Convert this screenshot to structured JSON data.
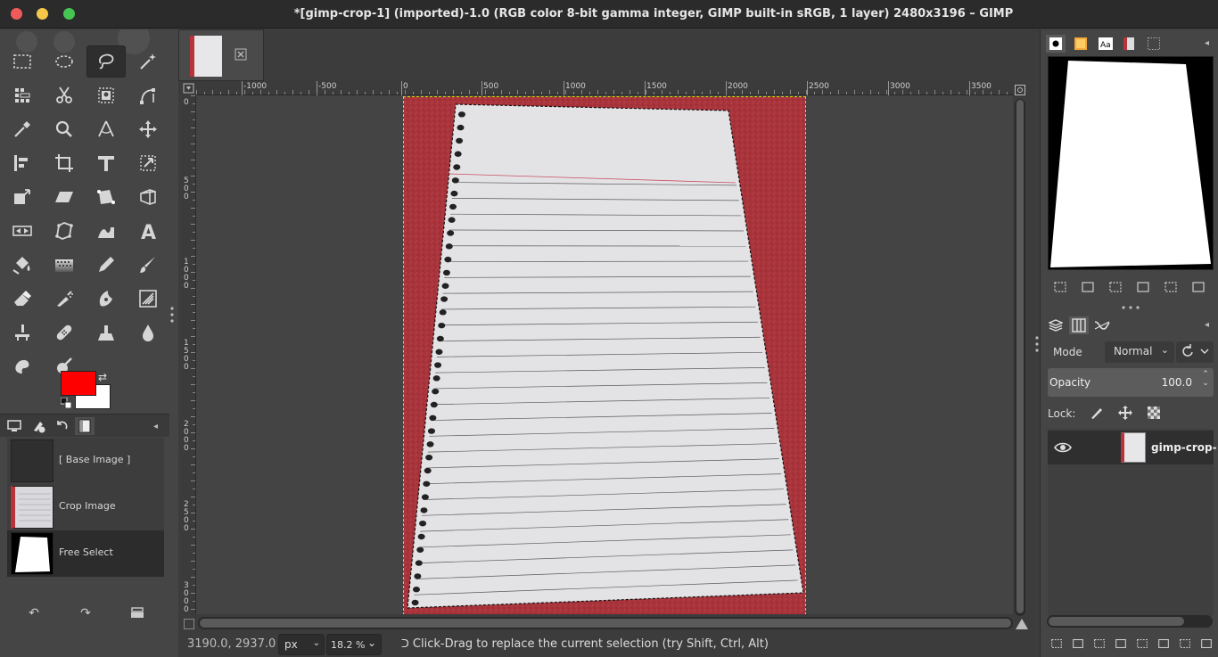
{
  "window": {
    "title": "*[gimp-crop-1] (imported)-1.0 (RGB color 8-bit gamma integer, GIMP built-in sRGB, 1 layer) 2480x3196 – GIMP"
  },
  "colors": {
    "foreground": "#ff0000",
    "background": "#ffffff",
    "paper_bg": "#a8333b"
  },
  "toolbox": {
    "tools": [
      "rect-select-icon",
      "ellipse-select-icon",
      "free-select-icon",
      "fuzzy-select-icon",
      "select-by-color-icon",
      "scissors-icon",
      "foreground-select-icon",
      "paths-icon",
      "color-picker-icon",
      "zoom-icon",
      "measure-icon",
      "move-icon",
      "align-icon",
      "crop-icon",
      "unified-transform-icon",
      "warp-transform-icon",
      "scale-icon",
      "shear-icon",
      "handle-transform-icon",
      "perspective-icon",
      "flip-icon",
      "cage-icon",
      "warp-icon",
      "text-icon",
      "bucket-fill-icon",
      "blend-icon",
      "pencil-icon",
      "paintbrush-icon",
      "eraser-icon",
      "airbrush-icon",
      "ink-icon",
      "mypaint-brush-icon",
      "clone-icon",
      "heal-icon",
      "perspective-clone-icon",
      "blur-icon",
      "smudge-icon",
      "dodge-burn-icon"
    ],
    "active_tool": "free-select-icon"
  },
  "undo_history": {
    "items": [
      {
        "label": "[ Base Image ]"
      },
      {
        "label": "Crop Image"
      },
      {
        "label": "Free Select"
      }
    ]
  },
  "ruler": {
    "h_labels": [
      "-1000",
      "-500",
      "0",
      "500",
      "1000",
      "1500",
      "2000",
      "2500",
      "3000",
      "3500"
    ],
    "v_labels": [
      "0",
      "500",
      "1000",
      "1500",
      "2000",
      "2500",
      "3000"
    ]
  },
  "statusbar": {
    "coords": "3190.0, 2937.0",
    "unit": "px",
    "zoom": "18.2 %",
    "message": "Click-Drag to replace the current selection (try Shift, Ctrl, Alt)"
  },
  "layers": {
    "mode_label": "Mode",
    "mode_value": "Normal",
    "opacity_label": "Opacity",
    "opacity_value": "100.0",
    "lock_label": "Lock:",
    "layer_name": "gimp-crop-"
  }
}
